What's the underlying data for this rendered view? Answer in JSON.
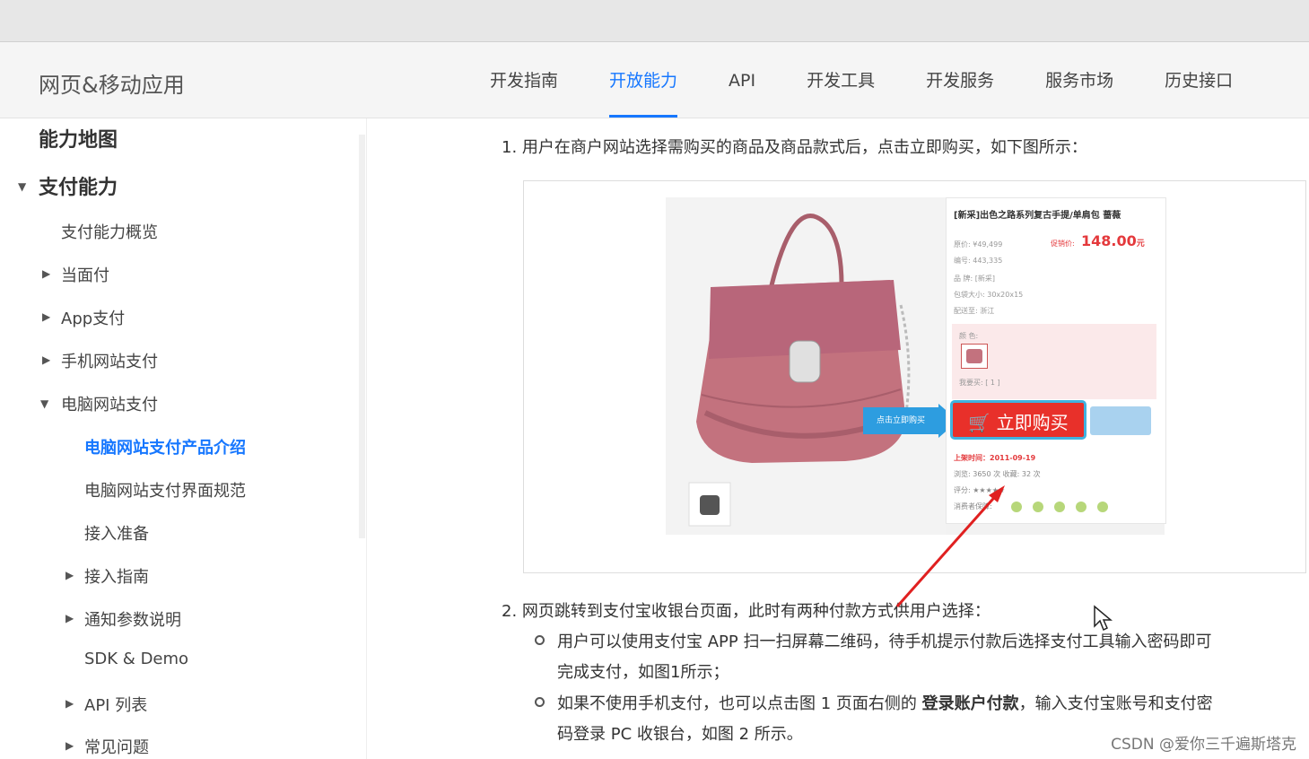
{
  "header": {
    "brand": "网页&移动应用",
    "nav": [
      "开发指南",
      "开放能力",
      "API",
      "开发工具",
      "开发服务",
      "服务市场",
      "历史接口"
    ],
    "active_nav": "开放能力"
  },
  "sidebar": {
    "items": [
      {
        "label": "能力地图"
      },
      {
        "label": "支付能力"
      },
      {
        "label": "支付能力概览"
      },
      {
        "label": "当面付"
      },
      {
        "label": "App支付"
      },
      {
        "label": "手机网站支付"
      },
      {
        "label": "电脑网站支付"
      },
      {
        "label": "电脑网站支付产品介绍"
      },
      {
        "label": "电脑网站支付界面规范"
      },
      {
        "label": "接入准备"
      },
      {
        "label": "接入指南"
      },
      {
        "label": "通知参数说明"
      },
      {
        "label": "SDK & Demo"
      },
      {
        "label": "API 列表"
      },
      {
        "label": "常见问题"
      }
    ]
  },
  "content": {
    "step1": "1. 用户在商户网站选择需购买的商品及商品款式后，点击立即购买，如下图所示：",
    "step2": "2. 网页跳转到支付宝收银台页面，此时有两种付款方式供用户选择：",
    "bullet1_line1": "用户可以使用支付宝 APP 扫一扫屏幕二维码，待手机提示付款后选择支付工具输入密码即可",
    "bullet1_line2": "完成支付，如图1所示；",
    "bullet2_line1_a": "如果不使用手机支付，也可以点击图 1 页面右侧的 ",
    "bullet2_line1_bold": "登录账户付款",
    "bullet2_line1_b": "，输入支付宝账号和支付密",
    "bullet2_line2": "码登录 PC 收银台，如图 2 所示。"
  },
  "product_screenshot": {
    "title": "[新采]出色之路系列复古手提/单肩包 蔷薇",
    "price": "148.00",
    "price_unit": "元",
    "buy_button": "立即购买",
    "hint": "点击立即购买",
    "date_label": "上架时间：",
    "date": "2011-09-19"
  },
  "watermark": "CSDN @爱你三千遍斯塔克",
  "colors": {
    "accent": "#1677ff",
    "buy": "#e8302a",
    "hint": "#2d9de0",
    "arrow": "#e02020",
    "bag": "#c3727e"
  }
}
